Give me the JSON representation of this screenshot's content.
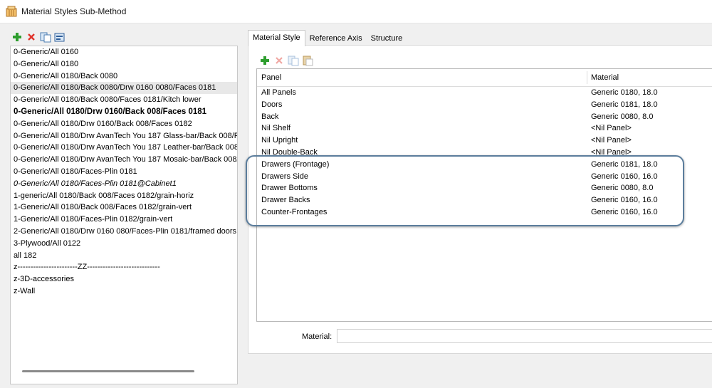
{
  "window": {
    "title": "Material Styles Sub-Method"
  },
  "left_toolbar": {
    "icons": [
      "add-icon",
      "delete-icon",
      "copy-icon",
      "properties-icon"
    ]
  },
  "styles_list": {
    "items": [
      "0-Generic/All 0160",
      "0-Generic/All 0180",
      "0-Generic/All 0180/Back 0080",
      "0-Generic/All 0180/Back 0080/Drw 0160 0080/Faces 0181",
      "0-Generic/All 0180/Back 0080/Faces 0181/Kitch lower",
      "0-Generic/All 0180/Drw 0160/Back 008/Faces 0181",
      "0-Generic/All 0180/Drw 0160/Back 008/Faces 0182",
      "0-Generic/All 0180/Drw AvanTech You 187 Glass-bar/Back 008/Fac",
      "0-Generic/All 0180/Drw AvanTech You 187 Leather-bar/Back 008/I",
      "0-Generic/All 0180/Drw AvanTech You 187 Mosaic-bar/Back 008/F",
      "0-Generic/All 0180/Faces-Plin 0181",
      "0-Generic/All 0180/Faces-Plin 0181@Cabinet1",
      "1-generic/All 0180/Back 008/Faces 0182/grain-horiz",
      "1-Generic/All 0180/Back 008/Faces 0182/grain-vert",
      "1-Generic/All 0180/Faces-Plin 0182/grain-vert",
      "2-Generic/All 0180/Drw 0160 080/Faces-Plin 0181/framed doors",
      "3-Plywood/All 0122",
      "all 182",
      "z-----------------------ZZ----------------------------",
      "z-3D-accessories",
      "z-Wall"
    ],
    "selected_index": 3,
    "bold_index": 5,
    "italic_index": 11
  },
  "tabs": [
    "Material Style",
    "Reference Axis",
    "Structure"
  ],
  "active_tab": 0,
  "grid_toolbar": {
    "icons": [
      "add-icon",
      "delete-icon",
      "copy-icon",
      "paste-icon"
    ]
  },
  "grid": {
    "columns": [
      "Panel",
      "Material"
    ],
    "rows": [
      {
        "panel": "All Panels",
        "material": "Generic 0180, 18.0"
      },
      {
        "panel": "Doors",
        "material": "Generic 0181, 18.0"
      },
      {
        "panel": "Back",
        "material": "Generic 0080, 8.0"
      },
      {
        "panel": "Nil Shelf",
        "material": "<Nil Panel>"
      },
      {
        "panel": "Nil Upright",
        "material": "<Nil Panel>"
      },
      {
        "panel": "Nil Double-Back",
        "material": "<Nil Panel>"
      },
      {
        "panel": "Drawers (Frontage)",
        "material": "Generic 0181, 18.0"
      },
      {
        "panel": "Drawers Side",
        "material": "Generic 0160, 16.0"
      },
      {
        "panel": "Drawer Bottoms",
        "material": "Generic 0080, 8.0"
      },
      {
        "panel": "Drawer Backs",
        "material": "Generic 0160, 16.0"
      },
      {
        "panel": "Counter-Frontages",
        "material": "Generic 0160, 16.0"
      }
    ]
  },
  "material_field": {
    "label": "Material:",
    "value": ""
  },
  "colors": {
    "add": "#2e9e2e",
    "delete": "#e0342b",
    "highlight_border": "#5b7d9c"
  }
}
